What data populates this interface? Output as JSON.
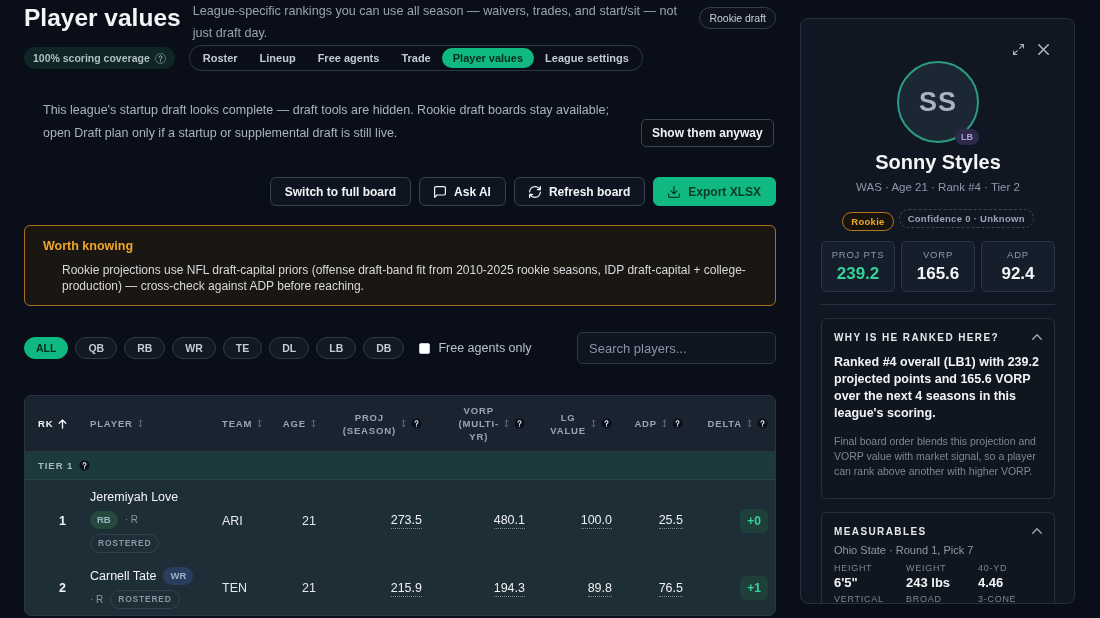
{
  "header": {
    "title": "Player values",
    "subtitle": "League-specific rankings you can use all season — waivers, trades, and start/sit — not just draft day.",
    "rookie_draft_button": "Rookie draft"
  },
  "coverage_chip": {
    "label": "100% scoring coverage"
  },
  "tabs": [
    {
      "label": "Roster",
      "selected": false
    },
    {
      "label": "Lineup",
      "selected": false
    },
    {
      "label": "Free agents",
      "selected": false
    },
    {
      "label": "Trade",
      "selected": false
    },
    {
      "label": "Player values",
      "selected": true
    },
    {
      "label": "League settings",
      "selected": false
    }
  ],
  "draft_notice": {
    "text": "This league's startup draft looks complete — draft tools are hidden. Rookie draft boards stay available; open Draft plan only if a startup or supplemental draft is still live.",
    "button": "Show them anyway"
  },
  "actions": [
    {
      "label": "Switch to full board",
      "kind": "plain",
      "primary": false
    },
    {
      "label": "Ask AI",
      "kind": "chat",
      "primary": false
    },
    {
      "label": "Refresh board",
      "kind": "refresh",
      "primary": false
    },
    {
      "label": "Export XLSX",
      "kind": "download",
      "primary": true
    }
  ],
  "callout": {
    "title": "Worth knowing",
    "text": "Rookie projections use NFL draft-capital priors (offense draft-band fit from 2010-2025 rookie seasons, IDP draft-capital + college-production) — cross-check against ADP before reaching."
  },
  "position_filters": [
    {
      "label": "ALL",
      "selected": true
    },
    {
      "label": "QB",
      "selected": false
    },
    {
      "label": "RB",
      "selected": false
    },
    {
      "label": "WR",
      "selected": false
    },
    {
      "label": "TE",
      "selected": false
    },
    {
      "label": "DL",
      "selected": false
    },
    {
      "label": "LB",
      "selected": false
    },
    {
      "label": "DB",
      "selected": false
    }
  ],
  "free_agents_only": {
    "label": "Free agents only",
    "checked": false
  },
  "search": {
    "placeholder": "Search players..."
  },
  "table": {
    "columns": [
      {
        "label": "RK",
        "sorted": true,
        "help": false
      },
      {
        "label": "PLAYER",
        "sorted": false,
        "help": false
      },
      {
        "label": "TEAM",
        "sorted": false,
        "help": false
      },
      {
        "label": "AGE",
        "sorted": false,
        "help": false
      },
      {
        "label": "PROJ (SEASON)",
        "sorted": false,
        "help": true
      },
      {
        "label": "VORP (MULTI-YR)",
        "sorted": false,
        "help": true
      },
      {
        "label": "LG VALUE",
        "sorted": false,
        "help": true
      },
      {
        "label": "ADP",
        "sorted": false,
        "help": true
      },
      {
        "label": "DELTA",
        "sorted": false,
        "help": true
      }
    ],
    "tiers": [
      {
        "label": "TIER 1",
        "rows": [
          {
            "rank": "1",
            "name": "Jeremiyah Love",
            "position": {
              "label": "RB",
              "color": "#25493f"
            },
            "rookie_marker": "· R",
            "status": "ROSTERED",
            "team": "ARI",
            "age": "21",
            "proj": "273.5",
            "vorp": "480.1",
            "lg_value": "100.0",
            "adp": "25.5",
            "delta": "+0"
          },
          {
            "rank": "2",
            "name": "Carnell Tate",
            "position": {
              "label": "WR",
              "color": "#2a3d5e"
            },
            "rookie_marker": "· R",
            "status": "ROSTERED",
            "team": "TEN",
            "age": "21",
            "proj": "215.9",
            "vorp": "194.3",
            "lg_value": "89.8",
            "adp": "76.5",
            "delta": "+1"
          }
        ]
      }
    ]
  },
  "player_panel": {
    "initials": "SS",
    "position": "LB",
    "name": "Sonny Styles",
    "meta": "WAS · Age 21 · Rank #4 · Tier 2",
    "badges": [
      {
        "label": "Rookie",
        "kind": "rookie"
      },
      {
        "label": "Confidence 0 · Unknown",
        "kind": "confidence"
      }
    ],
    "stats": [
      {
        "label": "PROJ PTS",
        "value": "239.2",
        "highlight": true
      },
      {
        "label": "VORP",
        "value": "165.6",
        "highlight": false
      },
      {
        "label": "ADP",
        "value": "92.4",
        "highlight": false
      }
    ],
    "sections": [
      {
        "kind": "explanation",
        "title": "WHY IS HE RANKED HERE?",
        "expanded": true,
        "summary": "Ranked #4 overall (LB1) with 239.2 projected points and 165.6 VORP over the next 4 seasons in this league's scoring.",
        "detail": "Final board order blends this projection and VORP value with market signal, so a player can rank above another with higher VORP."
      },
      {
        "kind": "measurables",
        "title": "MEASURABLES",
        "expanded": true,
        "subtitle": "Ohio State · Round 1, Pick 7",
        "metrics": [
          {
            "label": "HEIGHT",
            "value": "6'5\""
          },
          {
            "label": "WEIGHT",
            "value": "243 lbs"
          },
          {
            "label": "40-YD",
            "value": "4.46"
          },
          {
            "label": "VERTICAL"
          },
          {
            "label": "BROAD"
          },
          {
            "label": "3-CONE"
          }
        ]
      }
    ]
  }
}
